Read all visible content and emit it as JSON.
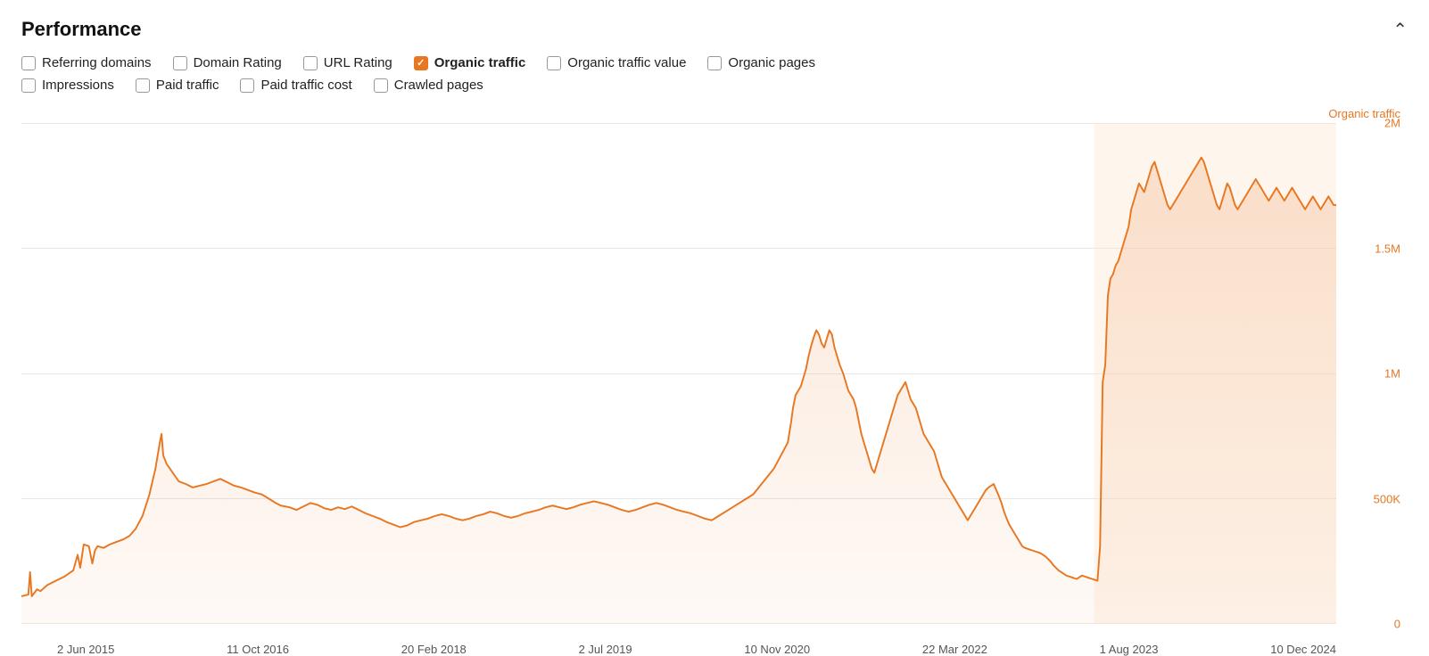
{
  "header": {
    "title": "Performance",
    "collapse_icon": "chevron-up"
  },
  "filters": {
    "row1": [
      {
        "id": "referring-domains",
        "label": "Referring domains",
        "checked": false
      },
      {
        "id": "domain-rating",
        "label": "Domain Rating",
        "checked": false
      },
      {
        "id": "url-rating",
        "label": "URL Rating",
        "checked": false
      },
      {
        "id": "organic-traffic",
        "label": "Organic traffic",
        "checked": true
      },
      {
        "id": "organic-traffic-value",
        "label": "Organic traffic value",
        "checked": false
      },
      {
        "id": "organic-pages",
        "label": "Organic pages",
        "checked": false
      }
    ],
    "row2": [
      {
        "id": "impressions",
        "label": "Impressions",
        "checked": false
      },
      {
        "id": "paid-traffic",
        "label": "Paid traffic",
        "checked": false
      },
      {
        "id": "paid-traffic-cost",
        "label": "Paid traffic cost",
        "checked": false
      },
      {
        "id": "crawled-pages",
        "label": "Crawled pages",
        "checked": false
      }
    ]
  },
  "chart": {
    "y_axis_label": "Organic traffic",
    "y_labels": [
      "2M",
      "1.5M",
      "1M",
      "500K",
      "0"
    ],
    "x_labels": [
      "2 Jun 2015",
      "11 Oct 2016",
      "20 Feb 2018",
      "2 Jul 2019",
      "10 Nov 2020",
      "22 Mar 2022",
      "1 Aug 2023",
      "10 Dec 2024"
    ],
    "accent_color": "#e87722",
    "highlighted_date": "11 Oct 2016"
  }
}
